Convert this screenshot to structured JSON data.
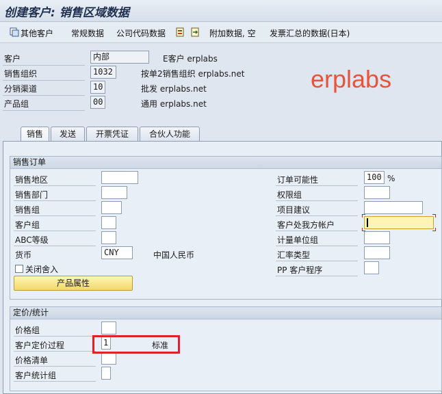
{
  "window": {
    "title": "创建客户: 销售区域数据"
  },
  "toolbar": {
    "other_customer": "其他客户",
    "general_data": "常规数据",
    "company_code_data": "公司代码数据",
    "additional_data": "附加数据, 空",
    "invoice_summary": "发票汇总的数据(日本)"
  },
  "header": {
    "customer_label": "客户",
    "customer_value": "内部",
    "customer_desc": "E客户 erplabs",
    "sales_org_label": "销售组织",
    "sales_org_value": "1032",
    "sales_org_desc": "按单2销售组织 erplabs.net",
    "dist_channel_label": "分销渠道",
    "dist_channel_value": "10",
    "dist_channel_desc": "批发 erplabs.net",
    "division_label": "产品组",
    "division_value": "00",
    "division_desc": "通用 erplabs.net"
  },
  "watermark": "erplabs",
  "tabs": [
    "销售",
    "发送",
    "开票凭证",
    "合伙人功能"
  ],
  "sales_order": {
    "title": "销售订单",
    "sales_district": "销售地区",
    "sales_office": "销售部门",
    "sales_group": "销售组",
    "customer_group": "客户组",
    "abc_class": "ABC等级",
    "currency_label": "货币",
    "currency_value": "CNY",
    "currency_desc": "中国人民币",
    "rounding_off": "关闭舍入",
    "product_attr_button": "产品属性",
    "order_prob_label": "订单可能性",
    "order_prob_value": "100",
    "order_prob_unit": "%",
    "auth_group": "权限组",
    "item_proposal": "项目建议",
    "acct_at_cust": "客户处我方帐户",
    "unit_group": "计量单位组",
    "exch_rate_type": "汇率类型",
    "pp_cust_proc": "PP 客户程序"
  },
  "pricing": {
    "title": "定价/统计",
    "price_group": "价格组",
    "cust_pric_proc_label": "客户定价过程",
    "cust_pric_proc_value": "1",
    "cust_pric_proc_desc": "标准",
    "price_list": "价格清单",
    "cust_stats_group": "客户统计组"
  }
}
